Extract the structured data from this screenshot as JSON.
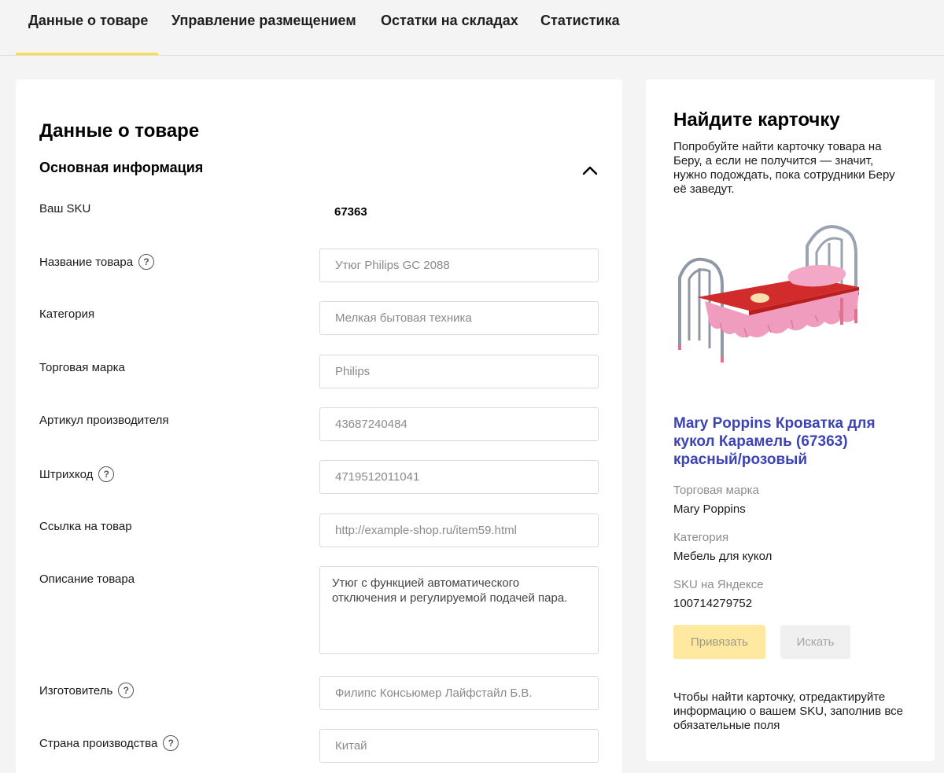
{
  "tabs": [
    {
      "label": "Данные о товаре",
      "active": true
    },
    {
      "label": "Управление размещением"
    },
    {
      "label": "Остатки на складах"
    },
    {
      "label": "Статистика"
    }
  ],
  "form": {
    "title": "Данные о товаре",
    "section_title": "Основная информация",
    "sku": {
      "label": "Ваш SKU",
      "value": "67363"
    },
    "fields": {
      "name": {
        "label": "Название товара",
        "placeholder": "Утюг Philips GC 2088"
      },
      "category": {
        "label": "Категория",
        "placeholder": "Мелкая бытовая техника"
      },
      "brand": {
        "label": "Торговая марка",
        "placeholder": "Philips"
      },
      "vendor_code": {
        "label": "Артикул производителя",
        "placeholder": "43687240484"
      },
      "barcode": {
        "label": "Штрихкод",
        "placeholder": "4719512011041"
      },
      "url": {
        "label": "Ссылка на товар",
        "placeholder": "http://example-shop.ru/item59.html"
      },
      "description": {
        "label": "Описание товара",
        "value": "Утюг с функцией автоматического\nотключения и регулируемой подачей пара."
      },
      "manufacturer": {
        "label": "Изготовитель",
        "placeholder": "Филипс Консьюмер Лайфстайл Б.В."
      },
      "country": {
        "label": "Страна производства",
        "placeholder": "Китай"
      }
    }
  },
  "side": {
    "title": "Найдите карточку",
    "description": "Попробуйте найти карточку товара на Беру, а если не получится — значит, нужно подождать, пока сотрудники Беру её заведут.",
    "product": {
      "title": "Mary Poppins Кроватка для кукол Карамель (67363) красный/розовый",
      "brand_label": "Торговая марка",
      "brand_value": "Mary Poppins",
      "category_label": "Категория",
      "category_value": "Мебель для кукол",
      "sku_label": "SKU на Яндексе",
      "sku_value": "100714279752"
    },
    "buttons": {
      "bind": "Привязать",
      "search": "Искать"
    },
    "note": "Чтобы найти карточку, отредактируйте информацию о вашем SKU, заполнив все обязательные поля"
  },
  "colors": {
    "accent": "#ffdb4d",
    "link": "#3c44b4",
    "background": "#f4f4f4"
  },
  "icons": [
    "chevron-up-icon",
    "question-icon"
  ]
}
